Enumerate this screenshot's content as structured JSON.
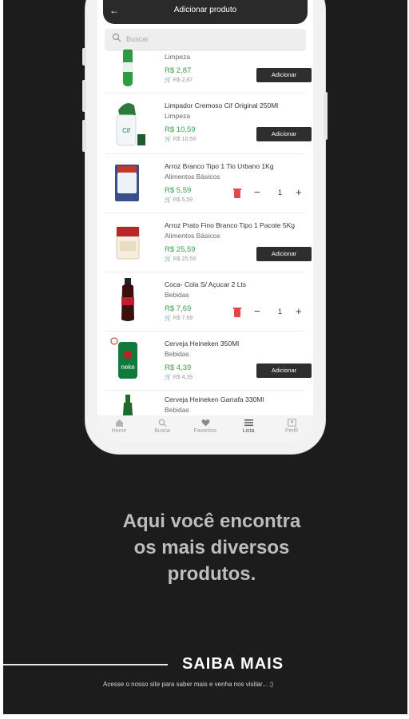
{
  "header": {
    "title": "Adicionar produto"
  },
  "search": {
    "placeholder": "Buscar"
  },
  "products": [
    {
      "name": "",
      "category": "Limpeza",
      "price": "R$ 2,87",
      "old_price": "R$ 2,87",
      "action": "Adicionar"
    },
    {
      "name": "Limpador Cremoso Cif Original 250Ml",
      "category": "Limpeza",
      "price": "R$ 10,59",
      "old_price": "R$ 10,59",
      "action": "Adicionar"
    },
    {
      "name": "Arroz Branco Tipo 1 Tio Urbano 1Kg",
      "category": "Alimentos Básicos",
      "price": "R$ 5,59",
      "old_price": "R$ 5,59",
      "quantity": "1"
    },
    {
      "name": "Arroz Prato Fino Branco Tipo 1 Pacote 5Kg",
      "category": "Alimentos Básicos",
      "price": "R$ 25,59",
      "old_price": "R$ 25,59",
      "action": "Adicionar"
    },
    {
      "name": "Coca- Cola S/ Açucar 2 Lts",
      "category": "Bebidas",
      "price": "R$ 7,69",
      "old_price": "R$ 7,69",
      "quantity": "1"
    },
    {
      "name": "Cerveja Heineken 350Ml",
      "category": "Bebidas",
      "price": "R$ 4,39",
      "old_price": "R$ 4,39",
      "action": "Adicionar"
    },
    {
      "name": "Cerveja Heineken Garrafa 330Ml",
      "category": "Bebidas"
    }
  ],
  "tabs": [
    {
      "label": "Home",
      "icon": "home-icon"
    },
    {
      "label": "Busca",
      "icon": "search-icon"
    },
    {
      "label": "Favoritos",
      "icon": "heart-icon"
    },
    {
      "label": "Lista",
      "icon": "list-icon",
      "active": true
    },
    {
      "label": "Perfil",
      "icon": "profile-icon"
    }
  ],
  "marketing": {
    "headline_line1": "Aqui você encontra",
    "headline_line2": "os mais diversos",
    "headline_line3": "produtos.",
    "cta": "SAIBA MAIS",
    "cta_sub": "Acesse o nosso site para saber mais e venha nos visitar... ;)"
  },
  "colors": {
    "background": "#1c1c1c",
    "price_green": "#3aa14a",
    "button_dark": "#2e2e2e"
  }
}
